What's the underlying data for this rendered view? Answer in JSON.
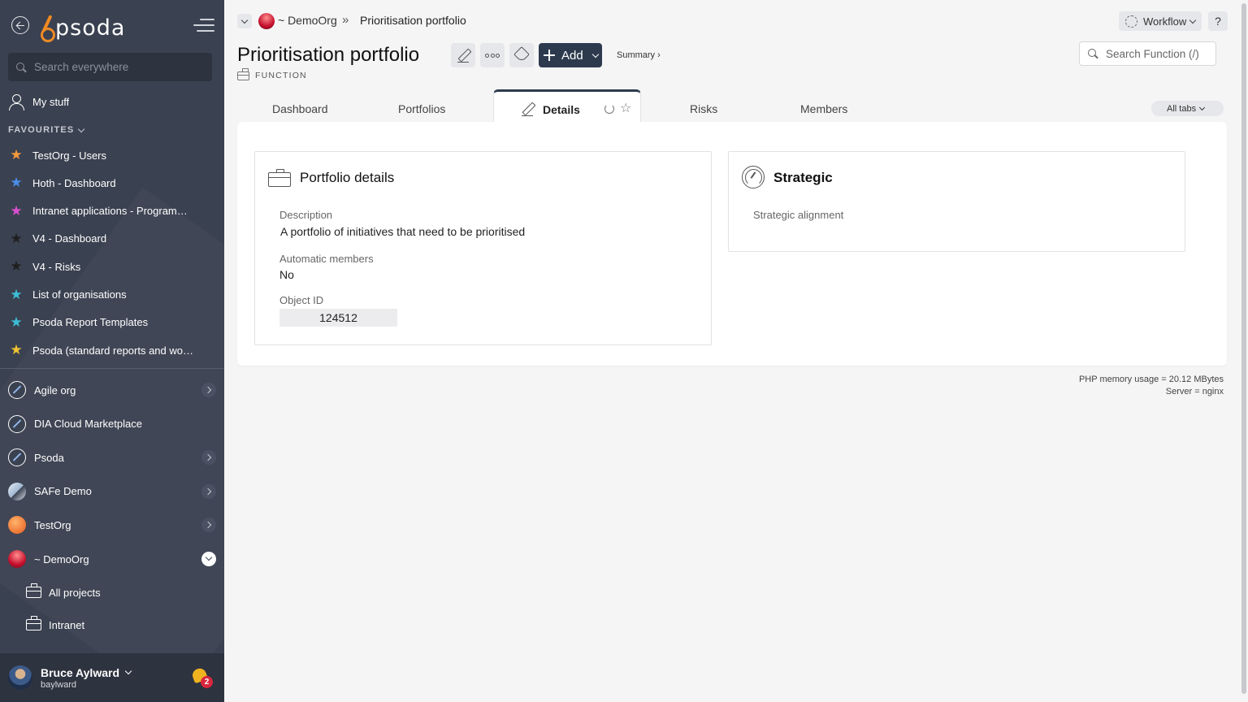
{
  "sidebar": {
    "search_placeholder": "Search everywhere",
    "my_stuff": "My stuff",
    "favourites_header": "FAVOURITES",
    "favourites": [
      {
        "label": "TestOrg - Users",
        "color": "#f39a3d"
      },
      {
        "label": "Hoth - Dashboard",
        "color": "#4a8ee8"
      },
      {
        "label": "Intranet applications - Programme...",
        "color": "#d84fd0"
      },
      {
        "label": "V4 - Dashboard",
        "color": "#1f1f1f"
      },
      {
        "label": "V4 - Risks",
        "color": "#1f1f1f"
      },
      {
        "label": "List of organisations",
        "color": "#3cbfd6"
      },
      {
        "label": "Psoda Report Templates",
        "color": "#3cbfd6"
      },
      {
        "label": "Psoda (standard reports and work...",
        "color": "#f0c330"
      }
    ],
    "orgs": [
      {
        "label": "Agile org",
        "logo": "pen",
        "arrow": "right"
      },
      {
        "label": "DIA Cloud Marketplace",
        "logo": "pen",
        "arrow": ""
      },
      {
        "label": "Psoda",
        "logo": "pen",
        "arrow": "right"
      },
      {
        "label": "SAFe Demo",
        "logo": "safe",
        "arrow": "right"
      },
      {
        "label": "TestOrg",
        "logo": "test",
        "arrow": "right"
      },
      {
        "label": "~ DemoOrg",
        "logo": "demo",
        "arrow": "open"
      }
    ],
    "sub_items": [
      "All projects",
      "Intranet"
    ],
    "user": {
      "name": "Bruce Aylward",
      "handle": "baylward",
      "notifications": "2"
    }
  },
  "logo_text": "psoda",
  "breadcrumb": {
    "org": "~ DemoOrg",
    "separator": "»",
    "current": "Prioritisation portfolio"
  },
  "header": {
    "title": "Prioritisation portfolio",
    "type_label": "FUNCTION",
    "add_label": "Add",
    "summary_label": "Summary ›",
    "workflow_label": "Workflow",
    "help_label": "?",
    "search_placeholder": "Search Function (/)"
  },
  "tabs": [
    {
      "label": "Dashboard"
    },
    {
      "label": "Portfolios"
    },
    {
      "label": "Details",
      "active": true
    },
    {
      "label": "Risks"
    },
    {
      "label": "Members"
    }
  ],
  "all_tabs_label": "All tabs",
  "portfolio_details": {
    "title": "Portfolio details",
    "description_label": "Description",
    "description_value": "A portfolio of initiatives that need to be prioritised",
    "auto_members_label": "Automatic members",
    "auto_members_value": "No",
    "object_id_label": "Object ID",
    "object_id_value": "124512"
  },
  "strategic": {
    "title": "Strategic",
    "alignment_label": "Strategic alignment"
  },
  "footer": {
    "memory": "PHP memory usage = 20.12 MBytes",
    "server": "Server = nginx"
  }
}
